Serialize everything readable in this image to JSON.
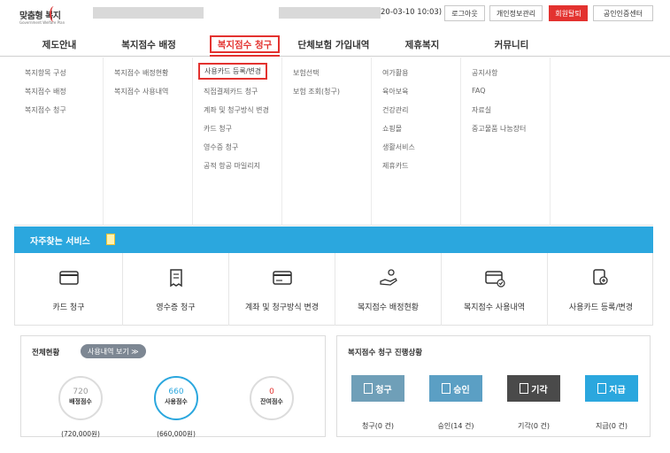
{
  "header": {
    "logo_text": "맞춤형 복지",
    "logo_sub": "Government Welfare Plan",
    "datetime": "20-03-10 10:03)",
    "buttons": [
      "로그아웃",
      "개인정보관리",
      "회원탈퇴",
      "공인인증센터"
    ]
  },
  "nav": [
    "제도안내",
    "복지점수 배정",
    "복지점수 청구",
    "단체보험 가입내역",
    "제휴복지",
    "커뮤니티"
  ],
  "menu_columns": [
    [
      "복지항목 구성",
      "복지점수 배정",
      "복지점수 청구"
    ],
    [
      "복지점수 배정현황",
      "복지점수 사용내역"
    ],
    [
      "사용카드 등록/변경",
      "직접결제카드 청구",
      "계좌 및 청구방식 변경",
      "카드 청구",
      "영수증 청구",
      "공적 항공 마일리지"
    ],
    [
      "보험선택",
      "보험 조회(청구)"
    ],
    [
      "여가활용",
      "육아보육",
      "건강관리",
      "쇼핑몰",
      "생활서비스",
      "제휴카드"
    ],
    [
      "공지사항",
      "FAQ",
      "자료실",
      "중고물품 나눔장터"
    ]
  ],
  "services": {
    "title": "자주찾는 서비스",
    "items": [
      {
        "label": "카드 청구",
        "icon": "card-icon"
      },
      {
        "label": "영수증 청구",
        "icon": "receipt-icon"
      },
      {
        "label": "계좌 및 청구방식 변경",
        "icon": "card-change-icon"
      },
      {
        "label": "복지점수 배정현황",
        "icon": "hand-coin-icon"
      },
      {
        "label": "복지점수 사용내역",
        "icon": "card-check-icon"
      },
      {
        "label": "사용카드 등록/변경",
        "icon": "card-register-icon"
      }
    ]
  },
  "status": {
    "title": "전체현황",
    "history_button": "사용내역 보기 ≫",
    "circles": [
      {
        "value": "720",
        "caption": "배정점수",
        "amount": "(720,000원)"
      },
      {
        "value": "660",
        "caption": "사용점수",
        "amount": "(660,000원)"
      },
      {
        "value": "0",
        "caption": "잔여점수",
        "amount": ""
      }
    ]
  },
  "progress": {
    "title": "복지점수 청구 진행상황",
    "steps": [
      {
        "label": "청구",
        "caption": "청구(0 건)",
        "color": "#6f9fb8"
      },
      {
        "label": "승인",
        "caption": "승인(14 건)",
        "color": "#5b9fc4"
      },
      {
        "label": "기각",
        "caption": "기각(0 건)",
        "color": "#4a4a4a"
      },
      {
        "label": "지급",
        "caption": "지급(0 건)",
        "color": "#2ba7de"
      }
    ]
  }
}
